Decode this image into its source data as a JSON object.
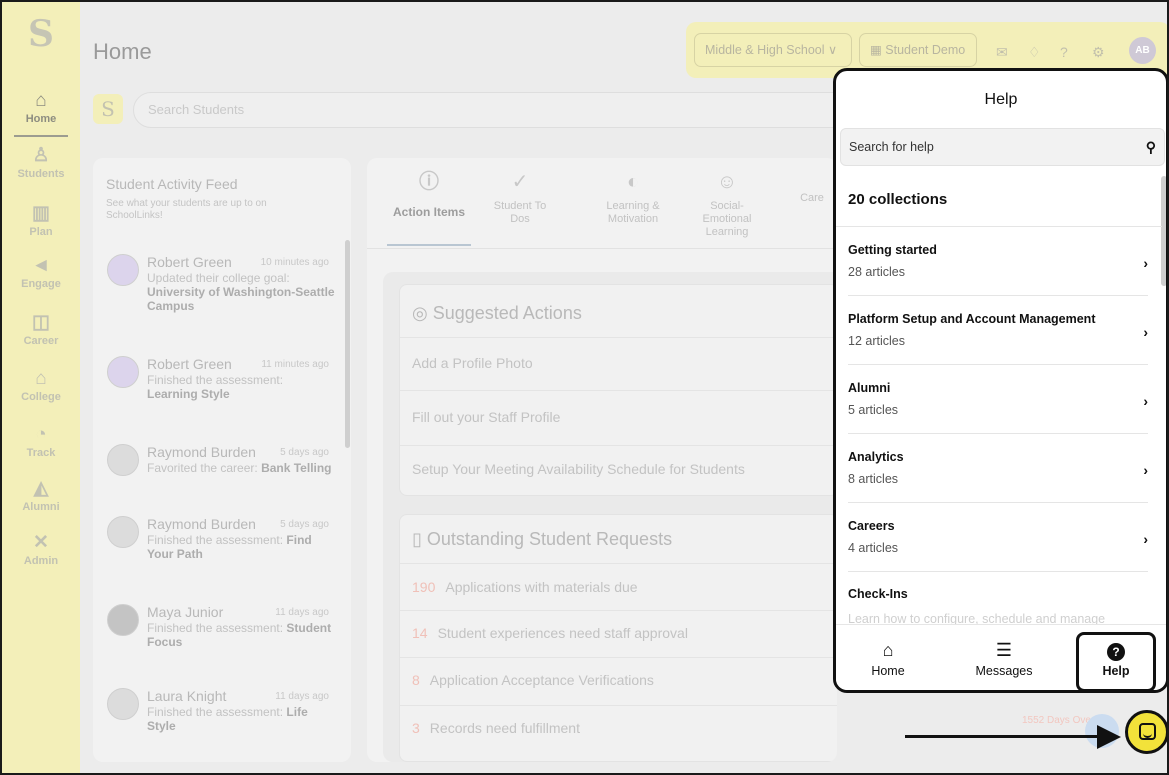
{
  "sidebar": {
    "logo": "S",
    "items": [
      {
        "label": "Home",
        "icon": "home-icon",
        "glyph": "⌂"
      },
      {
        "label": "Students",
        "icon": "person-icon",
        "glyph": "♙"
      },
      {
        "label": "Plan",
        "icon": "map-icon",
        "glyph": "▥"
      },
      {
        "label": "Engage",
        "icon": "megaphone-icon",
        "glyph": "◄"
      },
      {
        "label": "Career",
        "icon": "briefcase-icon",
        "glyph": "◫"
      },
      {
        "label": "College",
        "icon": "college-icon",
        "glyph": "⌂"
      },
      {
        "label": "Track",
        "icon": "pie-chart-icon",
        "glyph": "◔"
      },
      {
        "label": "Alumni",
        "icon": "graduation-cap-icon",
        "glyph": "◭"
      },
      {
        "label": "Admin",
        "icon": "tools-icon",
        "glyph": "✕"
      }
    ]
  },
  "header": {
    "title": "Home",
    "school_select": "Middle & High School ∨",
    "student_demo": "Student Demo",
    "avatar_initials": "AB"
  },
  "search": {
    "placeholder": "Search Students"
  },
  "feed": {
    "title": "Student Activity Feed",
    "subtitle": "See what your students are up to on SchoolLinks!",
    "items": [
      {
        "name": "Robert Green",
        "time": "10 minutes ago",
        "desc": "Updated their college goal:",
        "bold": "University of Washington-Seattle Campus"
      },
      {
        "name": "Robert Green",
        "time": "11 minutes ago",
        "desc": "Finished the assessment:",
        "bold": "Learning Style"
      },
      {
        "name": "Raymond Burden",
        "time": "5 days ago",
        "desc": "Favorited the career:",
        "bold": "Bank Telling"
      },
      {
        "name": "Raymond Burden",
        "time": "5 days ago",
        "desc": "Finished the assessment:",
        "bold": "Find Your Path"
      },
      {
        "name": "Maya Junior",
        "time": "11 days ago",
        "desc": "Finished the assessment:",
        "bold": "Student Focus"
      },
      {
        "name": "Laura Knight",
        "time": "11 days ago",
        "desc": "Finished the assessment:",
        "bold": "Life Style"
      }
    ]
  },
  "center": {
    "tabs": [
      {
        "label": "Action Items"
      },
      {
        "label": "Student To Dos"
      },
      {
        "label": "Learning & Motivation"
      },
      {
        "label": "Social-Emotional Learning"
      },
      {
        "label": "Care"
      }
    ],
    "suggested_title": "Suggested Actions",
    "suggested_rows": [
      "Add a Profile Photo",
      "Fill out your Staff Profile",
      "Setup Your Meeting Availability Schedule for Students"
    ],
    "requests_title": "Outstanding Student Requests",
    "requests_rows": [
      {
        "num": "190",
        "text": "Applications with materials due"
      },
      {
        "num": "14",
        "text": "Student experiences need staff approval"
      },
      {
        "num": "8",
        "text": "Application Acceptance Verifications"
      },
      {
        "num": "3",
        "text": "Records need fulfillment"
      }
    ],
    "overdue": "1552 Days Over"
  },
  "help": {
    "title": "Help",
    "search_placeholder": "Search for help",
    "collections_count": "20 collections",
    "collections": [
      {
        "title": "Getting started",
        "sub": "28 articles"
      },
      {
        "title": "Platform Setup and Account Management",
        "sub": "12 articles"
      },
      {
        "title": "Alumni",
        "sub": "5 articles"
      },
      {
        "title": "Analytics",
        "sub": "8 articles"
      },
      {
        "title": "Careers",
        "sub": "4 articles"
      },
      {
        "title": "Check-Ins",
        "sub": "Learn how to configure, schedule and manage"
      }
    ],
    "footer": {
      "home": "Home",
      "messages": "Messages",
      "help": "Help"
    }
  }
}
